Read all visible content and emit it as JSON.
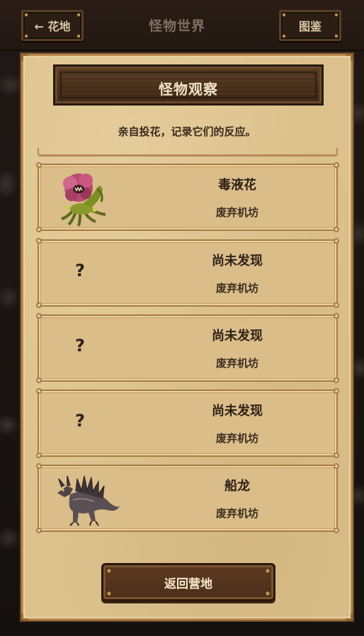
{
  "topbar": {
    "back_label": "← 花地",
    "title": "怪物世界",
    "atlas_label": "图鉴"
  },
  "panel": {
    "title": "怪物观察",
    "subtitle": "亲自投花，记录它们的反应。"
  },
  "monsters": [
    {
      "name": "毒液花",
      "location": "废弃机坊",
      "discovered": true,
      "art": "venom-flower-icon"
    },
    {
      "name": "尚未发现",
      "location": "废弃机坊",
      "discovered": false,
      "unknown_mark": "?"
    },
    {
      "name": "尚未发现",
      "location": "废弃机坊",
      "discovered": false,
      "unknown_mark": "?"
    },
    {
      "name": "尚未发现",
      "location": "废弃机坊",
      "discovered": false,
      "unknown_mark": "?"
    },
    {
      "name": "船龙",
      "location": "废弃机坊",
      "discovered": true,
      "art": "ship-dragon-icon"
    }
  ],
  "footer": {
    "return_label": "返回营地"
  },
  "colors": {
    "parchment": "#dcc18c",
    "wood_dark": "#4a311c",
    "text_dark": "#2e2218",
    "topbar_title": "#7e6f60"
  }
}
